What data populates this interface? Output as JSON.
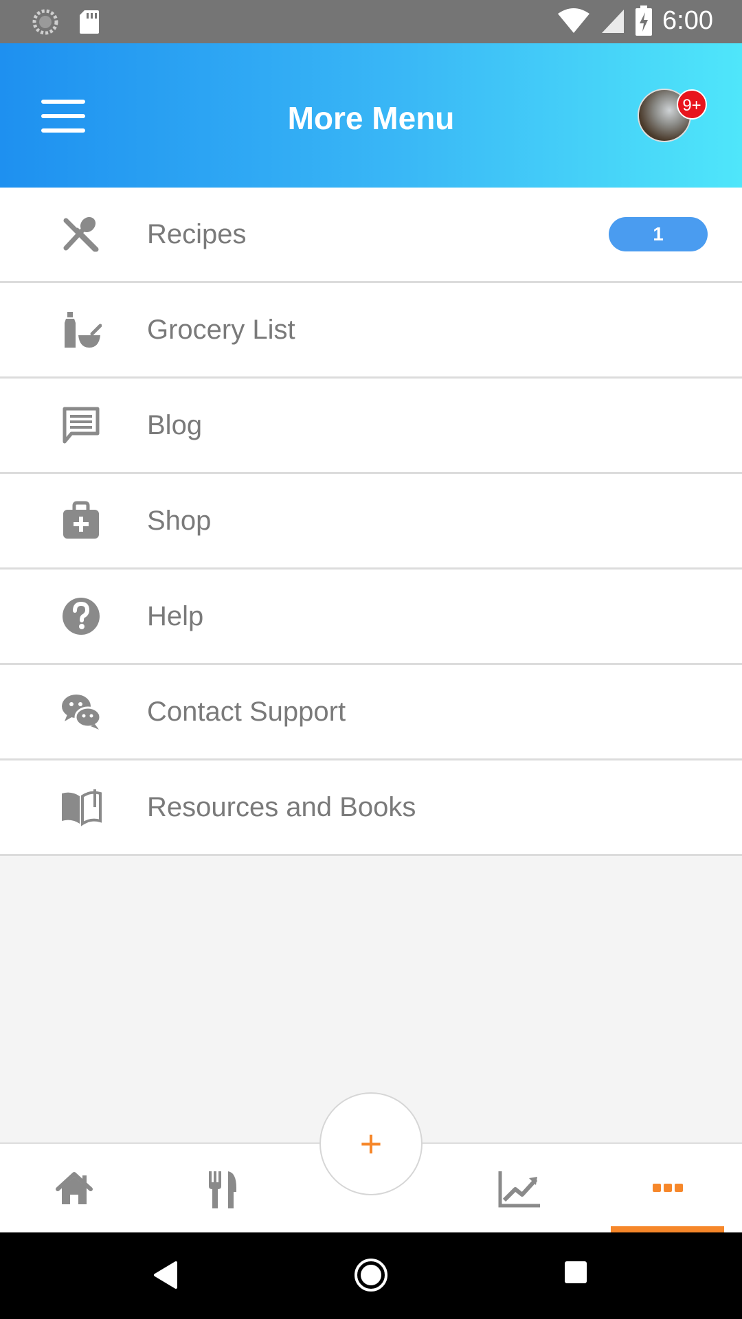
{
  "status_bar": {
    "time": "6:00",
    "icons": [
      "loading-icon",
      "sd-card-icon",
      "wifi-icon",
      "cell-signal-icon",
      "battery-charging-icon"
    ]
  },
  "app_bar": {
    "title": "More Menu",
    "menu_icon": "hamburger-icon",
    "notification_badge": "9+"
  },
  "menu": {
    "items": [
      {
        "label": "Recipes",
        "icon": "utensils-cross-icon",
        "count": "1"
      },
      {
        "label": "Grocery List",
        "icon": "grocery-bottle-bowl-icon"
      },
      {
        "label": "Blog",
        "icon": "message-icon"
      },
      {
        "label": "Shop",
        "icon": "medical-bag-icon"
      },
      {
        "label": "Help",
        "icon": "question-circle-icon"
      },
      {
        "label": "Contact Support",
        "icon": "chat-bubbles-icon"
      },
      {
        "label": "Resources and Books",
        "icon": "open-book-icon"
      }
    ]
  },
  "bottom_nav": {
    "items": [
      {
        "icon": "home-icon"
      },
      {
        "icon": "fork-knife-icon"
      },
      {
        "icon": "trend-chart-icon"
      },
      {
        "icon": "more-dots-icon",
        "active": true
      }
    ],
    "fab_label": "+"
  },
  "colors": {
    "accent": "#f6872a",
    "header_start": "#1e90f0",
    "header_end": "#4fe6fa",
    "badge_blue": "#4a9cf0",
    "notification_red": "#e8141c",
    "icon_gray": "#8a8a8a"
  }
}
